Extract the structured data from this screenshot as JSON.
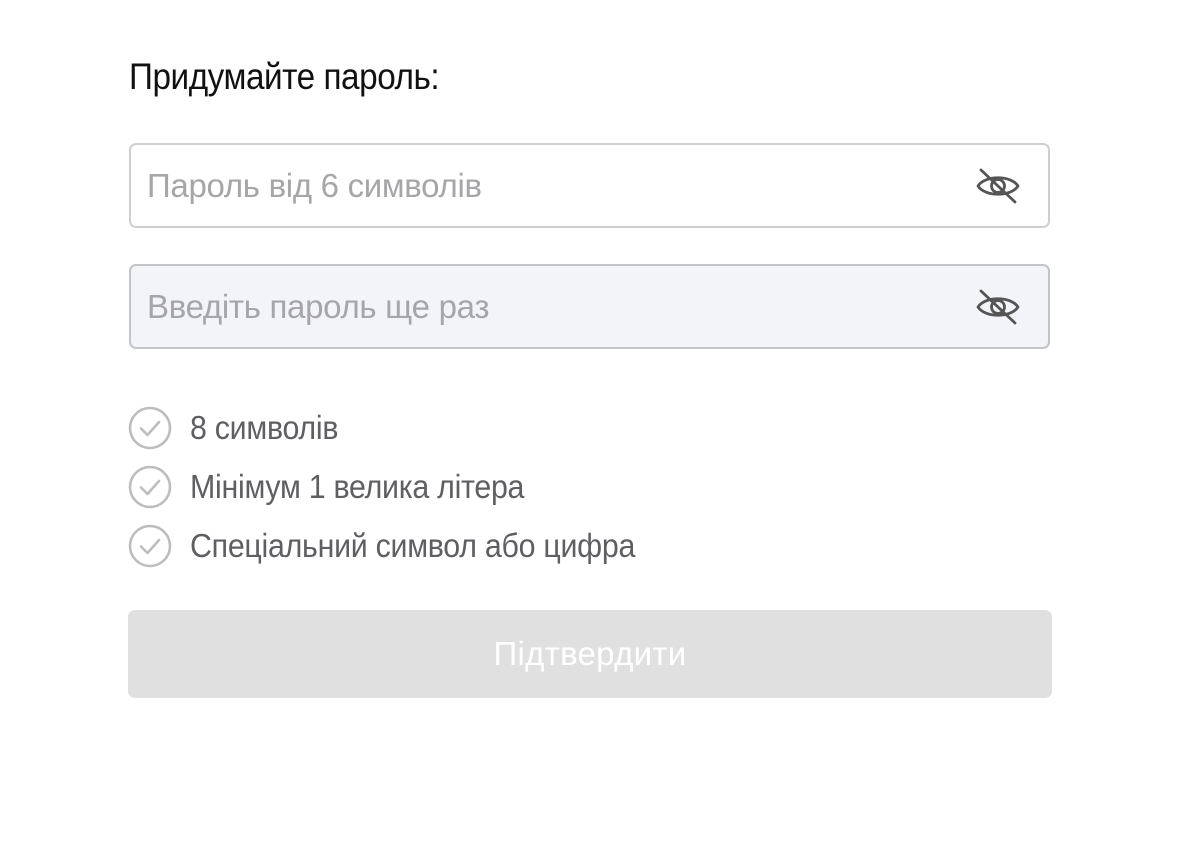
{
  "form": {
    "title": "Придумайте пароль:",
    "password_field": {
      "value": "",
      "placeholder": "Пароль від 6 символів",
      "toggle_icon": "eye-slash-icon"
    },
    "confirm_field": {
      "value": "",
      "placeholder": "Введіть пароль ще раз",
      "toggle_icon": "eye-slash-icon"
    },
    "requirements": [
      {
        "label": "8 символів",
        "icon": "check-circle-icon",
        "met": false
      },
      {
        "label": "Мінімум 1 велика літера",
        "icon": "check-circle-icon",
        "met": false
      },
      {
        "label": "Спеціальний символ або цифра",
        "icon": "check-circle-icon",
        "met": false
      }
    ],
    "submit_label": "Підтвердити",
    "submit_disabled": true
  },
  "colors": {
    "title_text": "#111111",
    "placeholder_text": "#a6a6a9",
    "requirement_text": "#5f5f63",
    "requirement_icon": "#bdbdbd",
    "field_border": "#cfcfd2",
    "confirm_field_background": "#f3f4f8",
    "button_disabled_background": "#e0e0e0",
    "button_disabled_text": "#ffffff"
  }
}
